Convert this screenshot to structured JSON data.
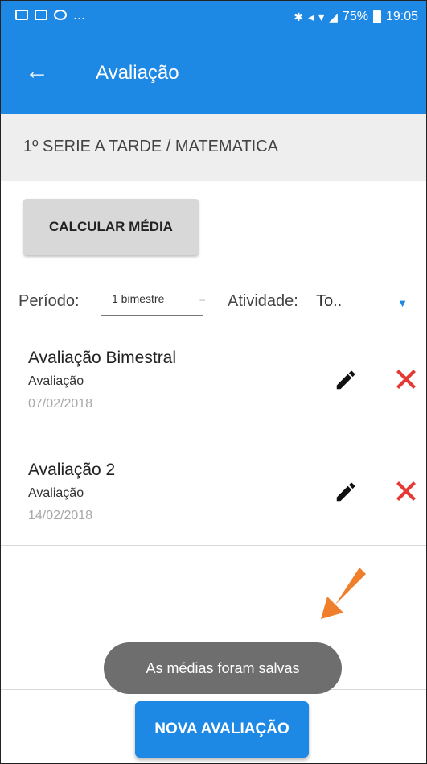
{
  "status_bar": {
    "dots": "...",
    "battery": "75%",
    "time": "19:05",
    "icons": [
      "image-icon",
      "mail-icon",
      "skype-icon",
      "bluetooth-icon",
      "mute-icon",
      "wifi-icon",
      "signal-icon",
      "battery-icon"
    ]
  },
  "appbar": {
    "back_icon": "arrow-left-icon",
    "title": "Avaliação",
    "color": "#1e88e5"
  },
  "class_header": "1º SERIE A  TARDE / MATEMATICA",
  "calc_button": "CALCULAR MÉDIA",
  "filters": {
    "period_label": "Período:",
    "period_value": "1 bimestre",
    "activity_label": "Atividade:",
    "activity_value": "To.."
  },
  "evaluations": [
    {
      "title": "Avaliação Bimestral",
      "type": "Avaliação",
      "date": "07/02/2018"
    },
    {
      "title": "Avaliação 2",
      "type": "Avaliação",
      "date": "14/02/2018"
    }
  ],
  "item_actions": {
    "edit_icon": "pencil-icon",
    "delete_icon": "close-x-icon",
    "delete_color": "#e53935"
  },
  "toast": "As médias foram salvas",
  "arrow_color": "#f07f2c",
  "fab_label": "NOVA AVALIAÇÃO"
}
